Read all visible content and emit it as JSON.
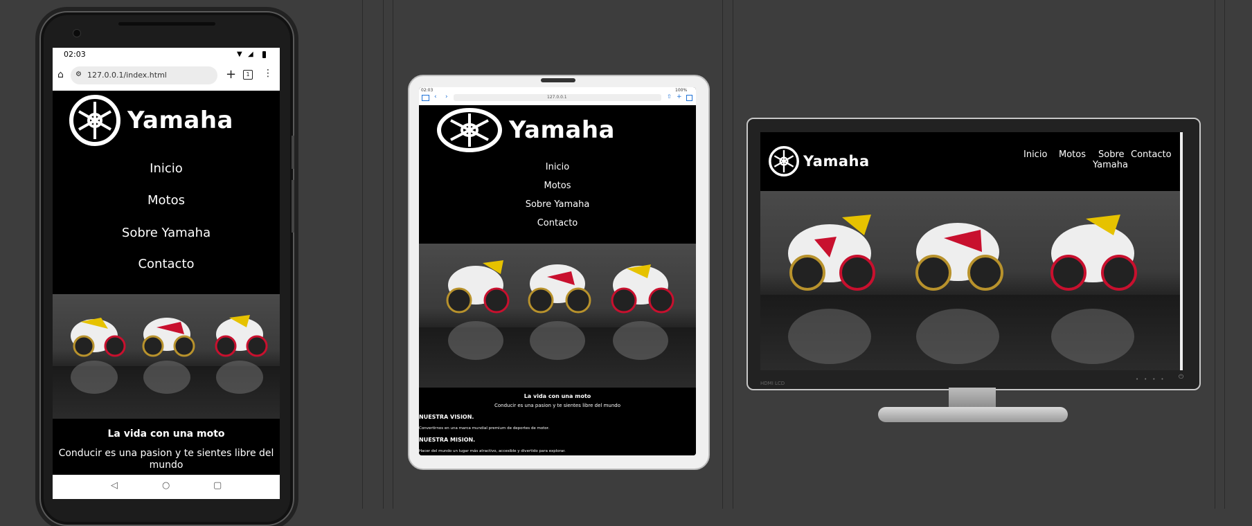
{
  "site": {
    "brand": "Yamaha",
    "nav": [
      "Inicio",
      "Motos",
      "Sobre Yamaha",
      "Contacto"
    ],
    "desktop_nav": [
      "Inicio",
      "Motos",
      "Sobre",
      "Yamaha",
      "Contacto"
    ],
    "tagline": "La vida con una moto",
    "subtitle": "Conducir es una pasion y te sientes libre del mundo",
    "vision_title": "NUESTRA VISION.",
    "vision_text": "Convertirnos en una marca mundial premium de deportes de motor.",
    "mission_title": "NUESTRA MISION.",
    "mission_text": "Hacer del mundo un lugar más atractivo, accesible y divertido para explorar."
  },
  "phone": {
    "time": "02:03",
    "url": "127.0.0.1/index.html",
    "tab_count": "1"
  },
  "tablet": {
    "time": "02:03",
    "url": "127.0.0.1",
    "battery": "100%"
  },
  "monitor": {
    "brand_label": "HDMI LCD"
  },
  "colors": {
    "background": "#3d3d3d",
    "site_bg": "#000000",
    "bike_red": "#c8102e",
    "bike_yellow": "#e6c200"
  }
}
